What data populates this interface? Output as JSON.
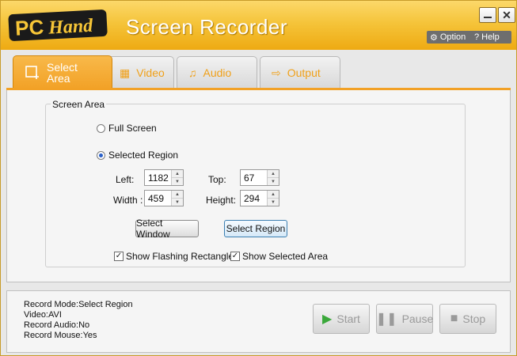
{
  "app": {
    "title": "Screen Recorder",
    "logo_text": "PC Hand",
    "option_label": "Option",
    "help_label": "Help",
    "accent_color": "#f2a126"
  },
  "tabs": [
    {
      "label": "Select Area",
      "icon": "crop-icon",
      "active": true
    },
    {
      "label": "Video",
      "icon": "film-icon",
      "active": false
    },
    {
      "label": "Audio",
      "icon": "music-icon",
      "active": false
    },
    {
      "label": "Output",
      "icon": "export-icon",
      "active": false
    }
  ],
  "screen_area": {
    "group_title": "Screen Area",
    "full_screen_label": "Full Screen",
    "selected_region_label": "Selected Region",
    "selected_option": "Selected Region",
    "left_label": "Left:",
    "left_value": "1182",
    "top_label": "Top:",
    "top_value": "67",
    "width_label": "Width :",
    "width_value": "459",
    "height_label": "Height:",
    "height_value": "294",
    "select_window_label": "Select Window",
    "select_region_label": "Select Region",
    "show_flashing_label": "Show Flashing Rectangle",
    "show_flashing_checked": true,
    "show_selected_label": "Show Selected Area",
    "show_selected_checked": true
  },
  "status": {
    "record_mode": "Record Mode:Select Region",
    "video": "Video:AVI",
    "record_audio": "Record Audio:No",
    "record_mouse": "Record Mouse:Yes"
  },
  "controls": {
    "start_label": "Start",
    "pause_label": "Pause",
    "stop_label": "Stop"
  }
}
